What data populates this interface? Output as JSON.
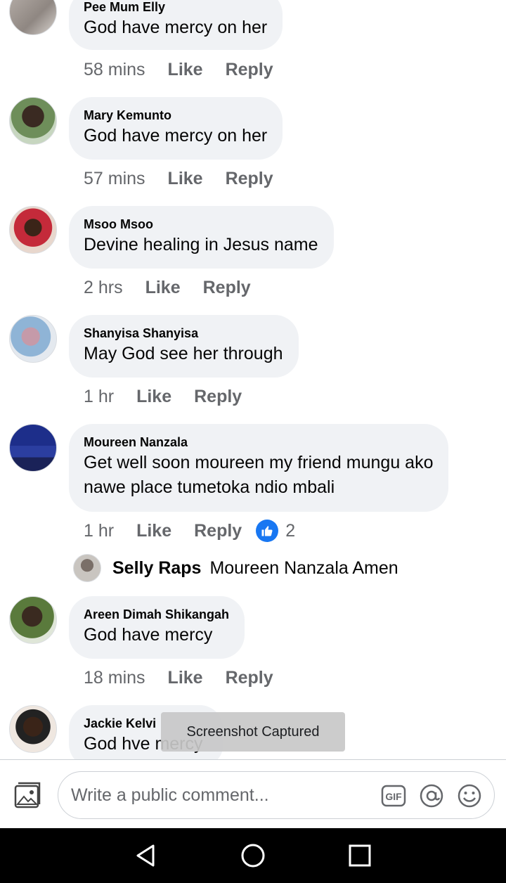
{
  "comments": [
    {
      "author": "Pee Mum Elly",
      "text": "God have mercy on her",
      "time": "58 mins",
      "like": "Like",
      "reply": "Reply"
    },
    {
      "author": "Mary Kemunto",
      "text": "God have mercy on her",
      "time": "57 mins",
      "like": "Like",
      "reply": "Reply"
    },
    {
      "author": "Msoo Msoo",
      "text": "Devine healing in Jesus name",
      "time": "2 hrs",
      "like": "Like",
      "reply": "Reply"
    },
    {
      "author": "Shanyisa Shanyisa",
      "text": "May God see her through",
      "time": "1 hr",
      "like": "Like",
      "reply": "Reply"
    },
    {
      "author": "Moureen Nanzala",
      "text": "Get well soon moureen my friend mungu ako\nnawe place tumetoka ndio mbali",
      "time": "1 hr",
      "like": "Like",
      "reply": "Reply",
      "reaction_count": "2"
    },
    {
      "author": "Areen Dimah Shikangah",
      "text": "God have mercy",
      "time": "18 mins",
      "like": "Like",
      "reply": "Reply"
    },
    {
      "author": "Jackie Kelvi",
      "text": "God hve mercy"
    }
  ],
  "reply_preview": {
    "author": "Selly Raps",
    "text": "Moureen Nanzala Amen"
  },
  "toast": "Screenshot Captured",
  "composer": {
    "placeholder": "Write a public comment...",
    "gif_label": "GIF"
  },
  "colors": {
    "bubble": "#f0f2f5",
    "meta_text": "#65676b",
    "like_blue": "#1877f2"
  },
  "icons": [
    "photo-icon",
    "gif-icon",
    "mention-icon",
    "emoji-icon",
    "back-icon",
    "home-icon",
    "recents-icon",
    "thumbs-up-icon"
  ]
}
